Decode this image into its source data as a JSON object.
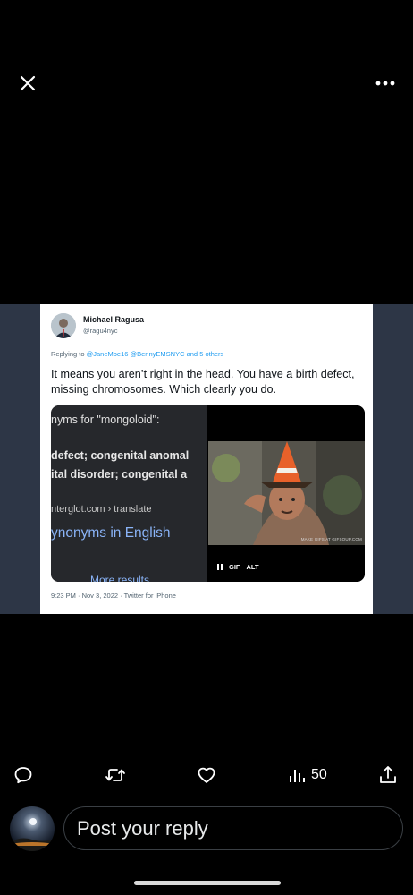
{
  "viewer": {
    "close_icon": "close-icon",
    "more_icon": "more-horizontal-icon"
  },
  "tweet": {
    "author_name": "Michael Ragusa",
    "author_handle": "@ragu4nyc",
    "replying_prefix": "Replying to",
    "replying_users": "@JaneMoe16 @BennyEMSNYC",
    "replying_and": "and",
    "replying_others": "5 others",
    "text": "It means you aren’t right in the head. You have a birth defect, missing chromosomes. Which clearly you do.",
    "timestamp": "9:23 PM · Nov 3, 2022 · Twitter for iPhone",
    "more_label": "···"
  },
  "screenshot_image": {
    "line1": "nyms for \"mongoloid\":",
    "line2": "defect; congenital anomal",
    "line3": "ital disorder; congenital a",
    "line4": "nterglot.com › translate",
    "line5": "ynonyms in English",
    "line6": "More results"
  },
  "gif": {
    "watermark": "MAKE GIFS AT GIFSOUP.COM",
    "badge": "GIF",
    "alt": "ALT",
    "pause_icon": "pause-icon"
  },
  "actions": {
    "reply_icon": "reply-icon",
    "retweet_icon": "retweet-icon",
    "like_icon": "heart-icon",
    "views_icon": "views-icon",
    "views_count": "50",
    "share_icon": "share-icon"
  },
  "composer": {
    "placeholder": "Post your reply"
  },
  "colors": {
    "background": "#000000",
    "media_backdrop": "#2d3646",
    "link_blue": "#1d9bf0",
    "muted_gray": "#536471"
  }
}
